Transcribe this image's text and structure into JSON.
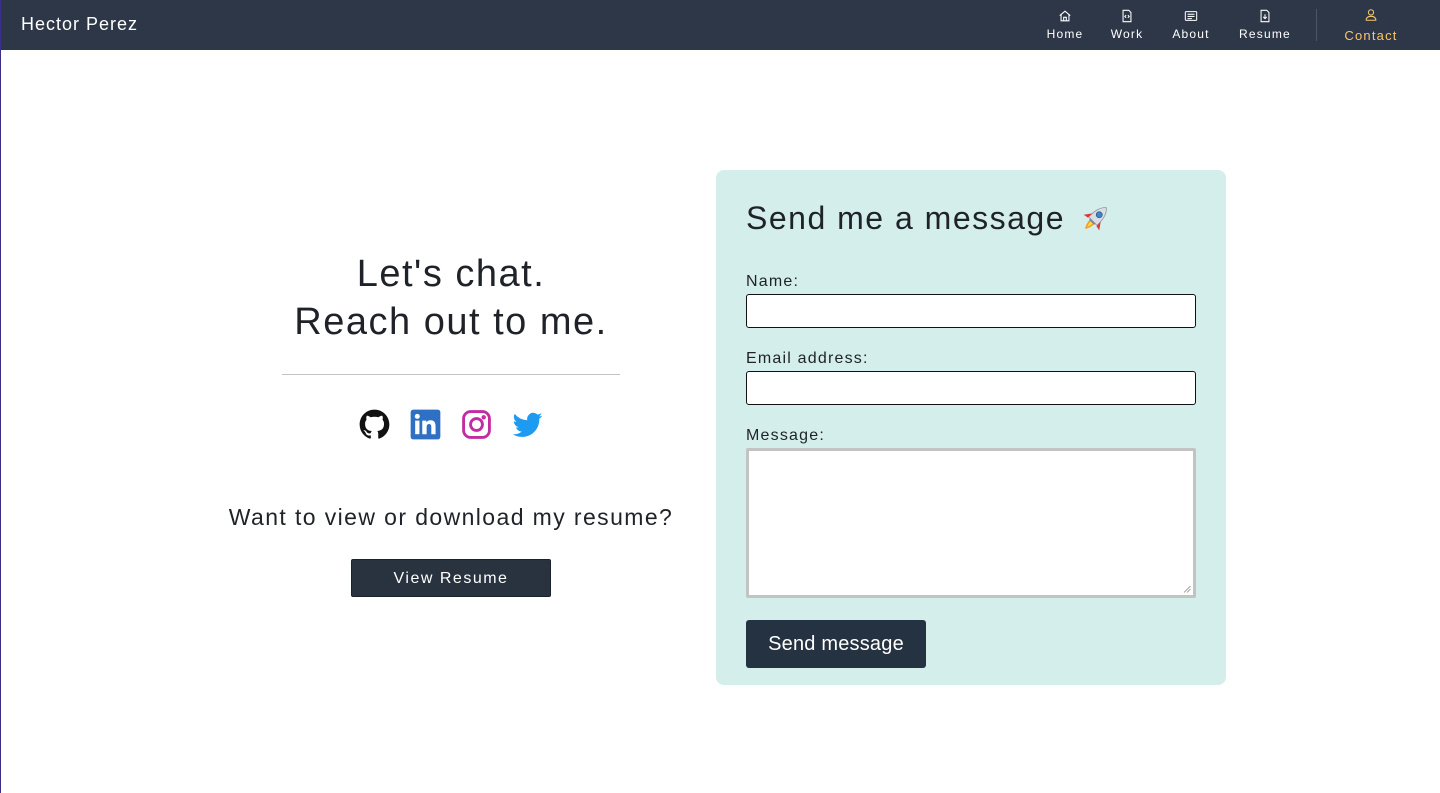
{
  "header": {
    "brand": "Hector Perez",
    "nav": {
      "home": "Home",
      "work": "Work",
      "about": "About",
      "resume": "Resume",
      "contact": "Contact"
    }
  },
  "left": {
    "headline_line1": "Let's chat.",
    "headline_line2": "Reach out to me.",
    "socials": [
      "github-icon",
      "linkedin-icon",
      "instagram-icon",
      "twitter-icon"
    ],
    "resume_question": "Want to view or download my resume?",
    "view_resume_label": "View Resume"
  },
  "form": {
    "title": "Send me a message",
    "name_label": "Name:",
    "name_value": "",
    "email_label": "Email address:",
    "email_value": "",
    "message_label": "Message:",
    "message_value": "",
    "submit_label": "Send message"
  },
  "colors": {
    "navbar": "#2d3748",
    "active_nav": "#f6c66b",
    "card_bg": "#d4eeec",
    "button": "#29333f",
    "linkedin": "#2f6fc4",
    "instagram": "#c32aa3",
    "twitter": "#1d9bf0"
  }
}
